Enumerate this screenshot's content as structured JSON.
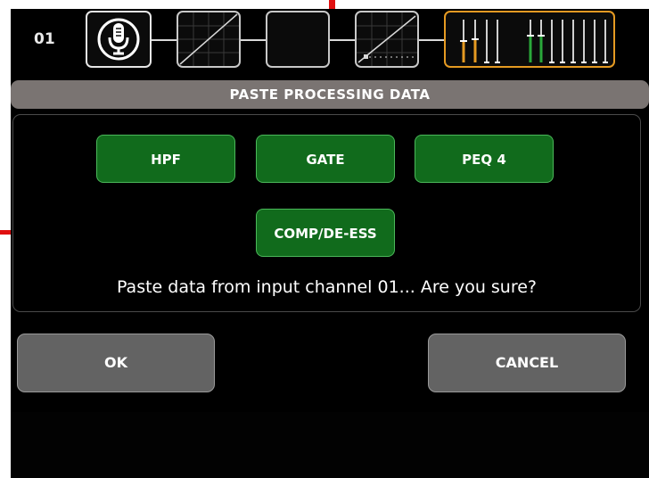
{
  "colors": {
    "screen_bg": "#000000",
    "dialog_bar": "#7a7472",
    "option_green": "#116b1c",
    "option_border": "#4bb85a",
    "button_gray": "#636363",
    "fader_accent": "#e59a22",
    "indicator_red": "#e01010"
  },
  "channel": {
    "number": "01"
  },
  "modules": [
    {
      "name": "input",
      "icon": "microphone-icon"
    },
    {
      "name": "hpf",
      "icon": "hpf-curve-icon"
    },
    {
      "name": "gate",
      "icon": "gate-icon"
    },
    {
      "name": "compressor",
      "icon": "compressor-curve-icon"
    },
    {
      "name": "faders",
      "icon": "fader-meter-icon"
    }
  ],
  "dialog": {
    "title": "PASTE PROCESSING DATA",
    "options": [
      {
        "label": "HPF"
      },
      {
        "label": "GATE"
      },
      {
        "label": "PEQ 4"
      },
      {
        "label": "COMP/DE-ESS"
      }
    ],
    "message": "Paste data from input channel 01... Are you sure?",
    "ok_label": "OK",
    "cancel_label": "CANCEL"
  }
}
